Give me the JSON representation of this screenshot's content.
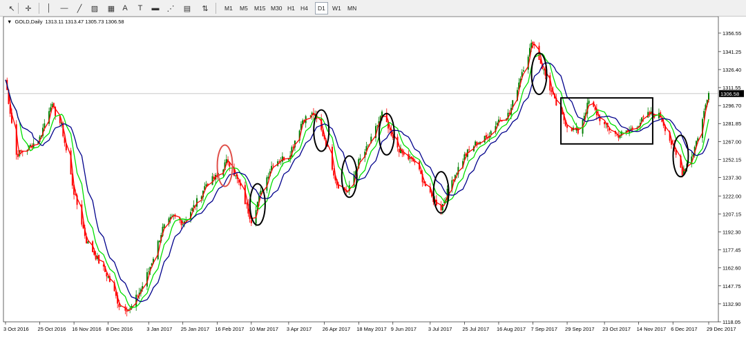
{
  "toolbar": {
    "tools": [
      {
        "name": "cursor-icon",
        "glyph": "↖"
      },
      {
        "name": "crosshair-icon",
        "glyph": "✛"
      },
      {
        "name": "vertical-line-icon",
        "glyph": "│"
      },
      {
        "name": "horizontal-line-icon",
        "glyph": "—"
      },
      {
        "name": "trendline-icon",
        "glyph": "╱"
      },
      {
        "name": "channel-icon",
        "glyph": "▨"
      },
      {
        "name": "fibonacci-icon",
        "glyph": "▦"
      },
      {
        "name": "text-icon",
        "glyph": "A"
      },
      {
        "name": "text-label-icon",
        "glyph": "T"
      },
      {
        "name": "rectangle-icon",
        "glyph": "▬"
      },
      {
        "name": "fan-icon",
        "glyph": "⋰"
      },
      {
        "name": "grid-fib-icon",
        "glyph": "▤"
      },
      {
        "name": "arrows-icon",
        "glyph": "⇅"
      }
    ],
    "timeframes": [
      "M1",
      "M5",
      "M15",
      "M30",
      "H1",
      "H4",
      "D1",
      "W1",
      "MN"
    ],
    "active_timeframe": "D1"
  },
  "chart": {
    "symbol_label": "GOLD,Daily",
    "ohlc": "1313.11 1313.47 1305.73 1306.58",
    "current_price": "1306.58",
    "colors": {
      "bull": "#008000",
      "bear": "#ff0000",
      "ma_fast": "#ff0000",
      "ma_mid": "#00e000",
      "ma_slow": "#00008b",
      "annot": "#000000",
      "annot_red": "#e0504a"
    }
  },
  "chart_data": {
    "type": "candlestick",
    "ylim": [
      1118.05,
      1364.0
    ],
    "y_ticks": [
      "1356.55",
      "1341.25",
      "1326.40",
      "1311.55",
      "1296.70",
      "1281.85",
      "1267.00",
      "1252.15",
      "1237.30",
      "1222.00",
      "1207.15",
      "1192.30",
      "1177.45",
      "1162.60",
      "1147.75",
      "1132.90",
      "1118.05"
    ],
    "x_ticks": [
      "3 Oct 2016",
      "25 Oct 2016",
      "16 Nov 2016",
      "8 Dec 2016",
      "3 Jan 2017",
      "25 Jan 2017",
      "16 Feb 2017",
      "10 Mar 2017",
      "3 Apr 2017",
      "26 Apr 2017",
      "18 May 2017",
      "9 Jun 2017",
      "3 Jul 2017",
      "25 Jul 2017",
      "16 Aug 2017",
      "7 Sep 2017",
      "29 Sep 2017",
      "23 Oct 2017",
      "14 Nov 2017",
      "6 Dec 2017",
      "29 Dec 2017"
    ],
    "close_path": [
      [
        "3 Oct 2016",
        1318
      ],
      [
        "10 Oct 2016",
        1256
      ],
      [
        "18 Oct 2016",
        1262
      ],
      [
        "25 Oct 2016",
        1270
      ],
      [
        "1 Nov 2016",
        1298
      ],
      [
        "8 Nov 2016",
        1280
      ],
      [
        "16 Nov 2016",
        1225
      ],
      [
        "24 Nov 2016",
        1185
      ],
      [
        "1 Dec 2016",
        1170
      ],
      [
        "8 Dec 2016",
        1155
      ],
      [
        "15 Dec 2016",
        1132
      ],
      [
        "22 Dec 2016",
        1128
      ],
      [
        "29 Dec 2016",
        1145
      ],
      [
        "3 Jan 2017",
        1160
      ],
      [
        "12 Jan 2017",
        1195
      ],
      [
        "19 Jan 2017",
        1205
      ],
      [
        "25 Jan 2017",
        1200
      ],
      [
        "2 Feb 2017",
        1215
      ],
      [
        "9 Feb 2017",
        1232
      ],
      [
        "16 Feb 2017",
        1238
      ],
      [
        "23 Feb 2017",
        1252
      ],
      [
        "2 Mar 2017",
        1232
      ],
      [
        "10 Mar 2017",
        1202
      ],
      [
        "17 Mar 2017",
        1228
      ],
      [
        "24 Mar 2017",
        1250
      ],
      [
        "3 Apr 2017",
        1255
      ],
      [
        "12 Apr 2017",
        1285
      ],
      [
        "19 Apr 2017",
        1290
      ],
      [
        "26 Apr 2017",
        1270
      ],
      [
        "4 May 2017",
        1232
      ],
      [
        "11 May 2017",
        1225
      ],
      [
        "18 May 2017",
        1250
      ],
      [
        "25 May 2017",
        1265
      ],
      [
        "2 Jun 2017",
        1290
      ],
      [
        "9 Jun 2017",
        1268
      ],
      [
        "16 Jun 2017",
        1255
      ],
      [
        "23 Jun 2017",
        1250
      ],
      [
        "3 Jul 2017",
        1222
      ],
      [
        "10 Jul 2017",
        1212
      ],
      [
        "17 Jul 2017",
        1235
      ],
      [
        "25 Jul 2017",
        1255
      ],
      [
        "1 Aug 2017",
        1265
      ],
      [
        "8 Aug 2017",
        1270
      ],
      [
        "16 Aug 2017",
        1285
      ],
      [
        "23 Aug 2017",
        1290
      ],
      [
        "31 Aug 2017",
        1325
      ],
      [
        "7 Sep 2017",
        1350
      ],
      [
        "14 Sep 2017",
        1325
      ],
      [
        "21 Sep 2017",
        1300
      ],
      [
        "29 Sep 2017",
        1280
      ],
      [
        "6 Oct 2017",
        1275
      ],
      [
        "13 Oct 2017",
        1300
      ],
      [
        "23 Oct 2017",
        1280
      ],
      [
        "31 Oct 2017",
        1272
      ],
      [
        "7 Nov 2017",
        1275
      ],
      [
        "14 Nov 2017",
        1282
      ],
      [
        "21 Nov 2017",
        1290
      ],
      [
        "28 Nov 2017",
        1288
      ],
      [
        "6 Dec 2017",
        1262
      ],
      [
        "12 Dec 2017",
        1242
      ],
      [
        "19 Dec 2017",
        1258
      ],
      [
        "25 Dec 2017",
        1285
      ],
      [
        "29 Dec 2017",
        1310
      ]
    ],
    "ma_windows": [
      3,
      8,
      14
    ],
    "annotations": [
      {
        "type": "ellipse",
        "date": "21 Feb 2017",
        "price": 1247,
        "color": "annot_red"
      },
      {
        "type": "ellipse",
        "date": "14 Mar 2017",
        "price": 1215,
        "color": "annot"
      },
      {
        "type": "ellipse",
        "date": "24 Apr 2017",
        "price": 1276,
        "color": "annot"
      },
      {
        "type": "ellipse",
        "date": "12 May 2017",
        "price": 1238,
        "color": "annot"
      },
      {
        "type": "ellipse",
        "date": "5 Jun 2017",
        "price": 1273,
        "color": "annot"
      },
      {
        "type": "ellipse",
        "date": "10 Jul 2017",
        "price": 1225,
        "color": "annot"
      },
      {
        "type": "ellipse",
        "date": "11 Sep 2017",
        "price": 1323,
        "color": "annot"
      },
      {
        "type": "ellipse",
        "date": "11 Dec 2017",
        "price": 1255,
        "color": "annot"
      },
      {
        "type": "rect",
        "from_date": "25 Sep 2017",
        "to_date": "23 Nov 2017",
        "from_price": 1265,
        "to_price": 1303,
        "color": "annot"
      }
    ]
  }
}
